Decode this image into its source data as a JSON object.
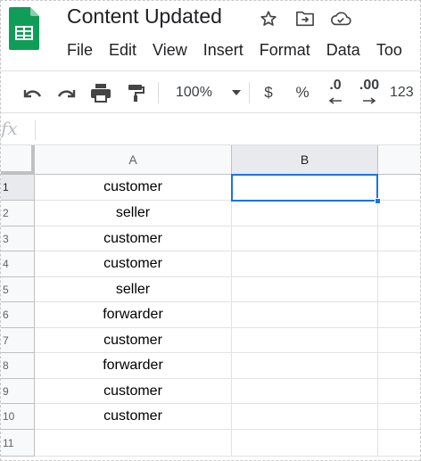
{
  "document": {
    "title": "Content Updated",
    "icons": [
      "star-icon",
      "move-to-folder-icon",
      "cloud-saved-icon"
    ]
  },
  "menu": [
    "File",
    "Edit",
    "View",
    "Insert",
    "Format",
    "Data",
    "Too"
  ],
  "toolbar": {
    "zoom": "100%",
    "currency": "$",
    "percent": "%",
    "decrease_decimal": ".0",
    "increase_decimal": ".00",
    "more_formats": "123"
  },
  "formula_bar": {
    "label": "fx",
    "value": ""
  },
  "sheet": {
    "columns": [
      "A",
      "B"
    ],
    "rows": [
      "1",
      "2",
      "3",
      "4",
      "5",
      "6",
      "7",
      "8",
      "9",
      "10",
      "11"
    ],
    "column_a_values": [
      "customer",
      "seller",
      "customer",
      "customer",
      "seller",
      "forwarder",
      "customer",
      "forwarder",
      "customer",
      "customer",
      ""
    ],
    "selected_cell": "B1"
  },
  "colors": {
    "accent": "#1a73e8",
    "logo_green": "#0f9d58",
    "header_bg": "#f8f9fa",
    "active_header_bg": "#e8eaed"
  }
}
